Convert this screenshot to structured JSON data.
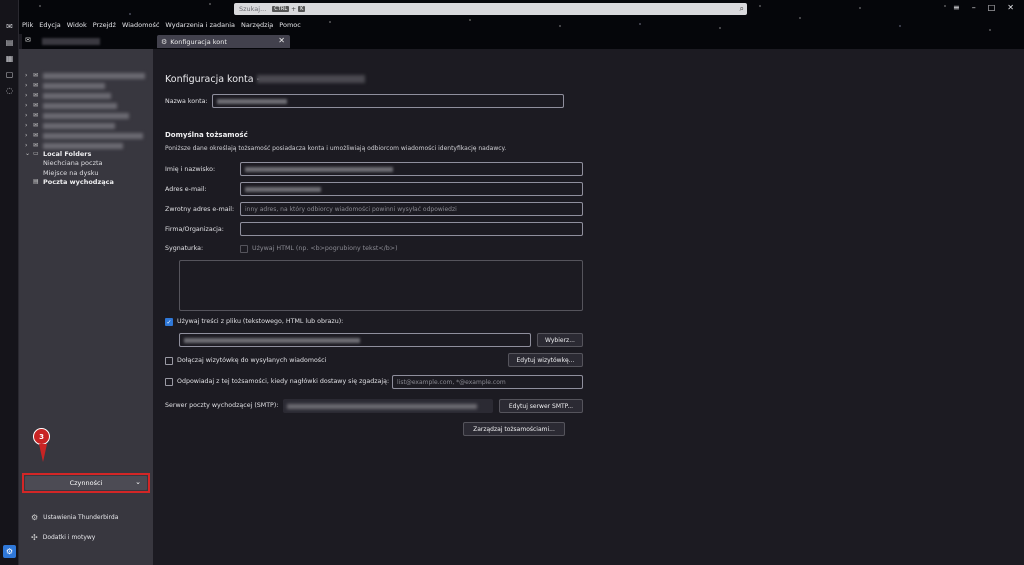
{
  "search": {
    "placeholder": "Szukaj...",
    "shortcut_mod": "CTRL",
    "shortcut_plus": "+",
    "shortcut_key": "K"
  },
  "menu": [
    "Plik",
    "Edycja",
    "Widok",
    "Przejdź",
    "Wiadomość",
    "Wydarzenia i zadania",
    "Narzędzia",
    "Pomoc"
  ],
  "window_controls": {
    "menu_icon": "≡",
    "minimize": "–",
    "maximize": "□",
    "close": "✕"
  },
  "tab": {
    "label": "Konfiguracja kont",
    "close": "✕"
  },
  "folders": {
    "local_folders": "Local Folders",
    "local_children": [
      "Niechciana poczta",
      "Miejsce na dysku"
    ],
    "outbox": "Poczta wychodząca"
  },
  "sidebar": {
    "badge": "3",
    "actions_label": "Czynności",
    "settings_label": "Ustawienia Thunderbirda",
    "addons_label": "Dodatki i motywy"
  },
  "content": {
    "title": "Konfiguracja konta -",
    "account_name_label": "Nazwa konta:",
    "identity_heading": "Domyślna tożsamość",
    "identity_desc": "Poniższe dane określają tożsamość posiadacza konta i umożliwiają odbiorcom wiadomości identyfikację nadawcy.",
    "name_label": "Imię i nazwisko:",
    "email_label": "Adres e-mail:",
    "reply_label": "Zwrotny adres e-mail:",
    "reply_placeholder": "inny adres, na który odbiorcy wiadomości powinni wysyłać odpowiedzi",
    "org_label": "Firma/Organizacja:",
    "signature_label": "Sygnaturka:",
    "use_html_label": "Używaj HTML (np. <b>pogrubiony tekst</b>)",
    "use_file_label": "Używaj treści z pliku (tekstowego, HTML lub obrazu):",
    "choose_button": "Wybierz...",
    "attach_vcard_label": "Dołączaj wizytówkę do wysyłanych wiadomości",
    "edit_vcard_button": "Edytuj wizytówkę...",
    "reply_identity_label": "Odpowiadaj z tej tożsamości, kiedy nagłówki dostawy się zgadzają:",
    "reply_identity_placeholder": "list@example.com, *@example.com",
    "smtp_label": "Serwer poczty wychodzącej (SMTP):",
    "edit_smtp_button": "Edytuj serwer SMTP...",
    "manage_identities_button": "Zarządzaj tożsamościami..."
  }
}
